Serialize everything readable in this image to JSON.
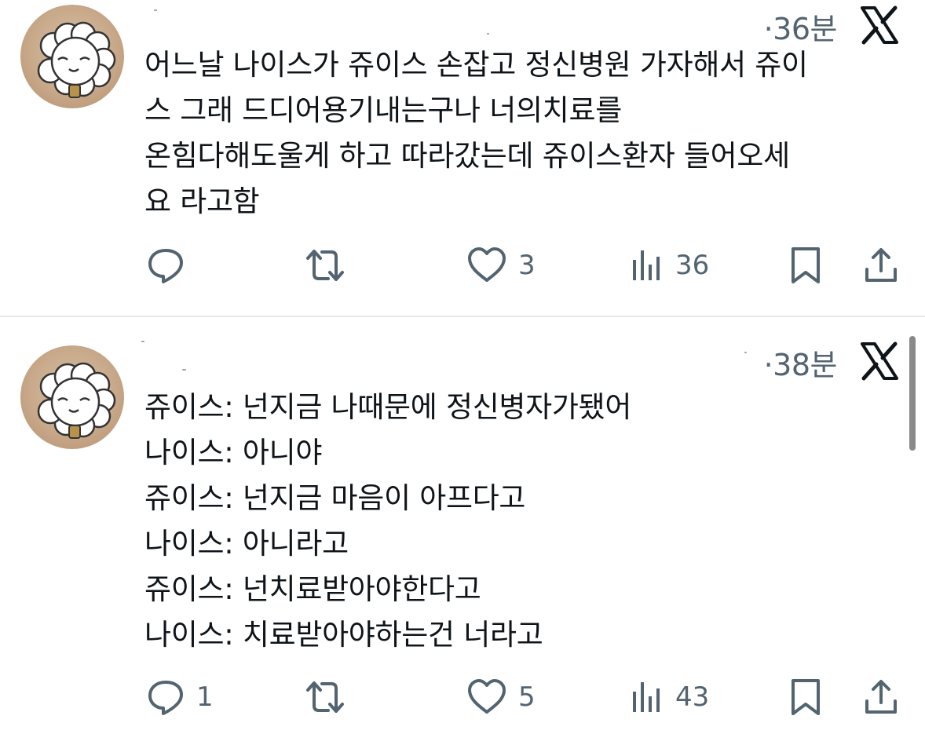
{
  "tweets": [
    {
      "time": "·36분",
      "lines": [
        "어느날 나이스가 쥬이스 손잡고 정신병원 가자해서 쥬이",
        "스 그래 드디어용기내는구나 너의치료를",
        "온힘다해도울게 하고 따라갔는데 쥬이스환자 들어오세",
        "요 라고함"
      ],
      "actions": {
        "reply_count": "",
        "repost_count": "",
        "like_count": "3",
        "views_count": "36"
      }
    },
    {
      "time": "·38분",
      "lines": [
        "쥬이스: 넌지금 나때문에 정신병자가됐어",
        "나이스: 아니야",
        "쥬이스: 넌지금 마음이 아프다고",
        "나이스: 아니라고",
        "쥬이스: 넌치료받아야한다고",
        "나이스: 치료받아야하는건 너라고"
      ],
      "actions": {
        "reply_count": "1",
        "repost_count": "",
        "like_count": "5",
        "views_count": "43"
      }
    }
  ],
  "icons": {
    "reply": "reply-icon",
    "repost": "repost-icon",
    "like": "heart-icon",
    "views": "views-chart-icon",
    "bookmark": "bookmark-icon",
    "share": "share-icon",
    "brand": "x-logo-icon"
  },
  "colors": {
    "text": "#0f1419",
    "muted": "#536471",
    "divider": "#e6e8ea"
  }
}
